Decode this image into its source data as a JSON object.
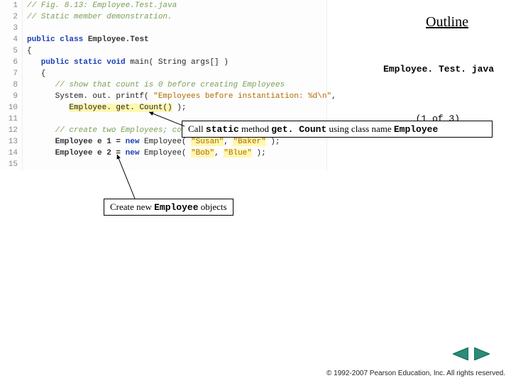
{
  "outline_label": "Outline",
  "file_name": "Employee. Test. java",
  "page_indicator": "(1  of   3)",
  "callout1": {
    "pre": "Call ",
    "kw1": "static",
    "mid": " method ",
    "kw2": "get. Count",
    "post": " using class name ",
    "kw3": "Employee"
  },
  "callout2": {
    "pre": "Create new ",
    "kw1": "Employee",
    "post": " objects"
  },
  "copyright": "© 1992-2007 Pearson Education, Inc.  All rights reserved.",
  "code": {
    "l1": "// Fig. 8.13: Employee.Test.java",
    "l2": "// Static member demonstration.",
    "l4a": "public class ",
    "l4b": "Employee.Test",
    "l5": "{",
    "l6a": "   public static ",
    "l6b": "void",
    "l6c": " main( String args[] )",
    "l7": "   {",
    "l8": "      // show that count is 0 before creating Employees",
    "l9a": "      System. out. printf( ",
    "l9b": "\"Employees before instantiation: %d\\n\"",
    "l9c": ", ",
    "l10a": "         ",
    "l10b": "Employee. get. Count()",
    "l10c": " );",
    "l12": "      // create two Employees; count should be 2",
    "l13a": "      Employee e 1 = ",
    "l13b": "new",
    "l13c": " Employee( ",
    "l13d": "\"Susan\"",
    "l13e": ", ",
    "l13f": "\"Baker\"",
    "l13g": " );",
    "l14a": "      Employee e 2 = ",
    "l14b": "new",
    "l14c": " Employee( ",
    "l14d": "\"Bob\"",
    "l14e": ", ",
    "l14f": "\"Blue\"",
    "l14g": " );"
  },
  "line_numbers": [
    "1",
    "2",
    "3",
    "4",
    "5",
    "6",
    "7",
    "8",
    "9",
    "10",
    "11",
    "12",
    "13",
    "14",
    "15"
  ]
}
